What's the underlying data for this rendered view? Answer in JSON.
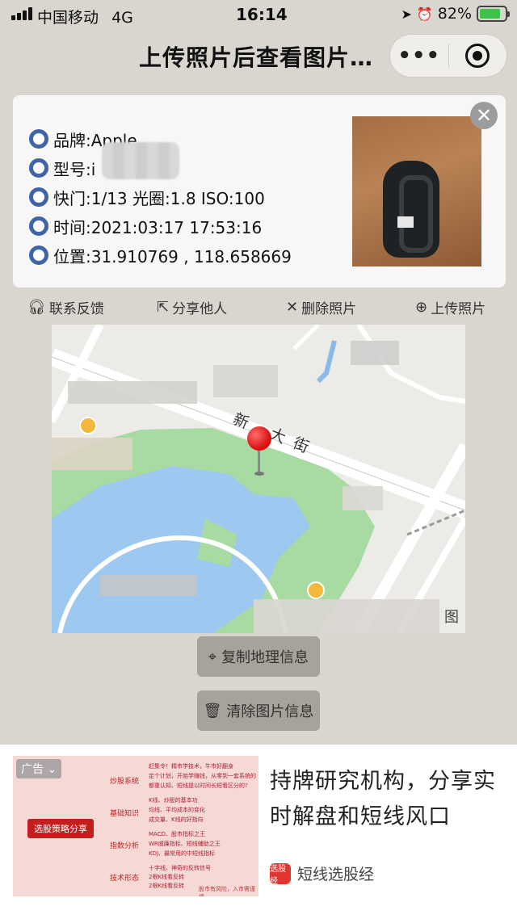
{
  "status_bar": {
    "carrier": "中国移动",
    "network": "4G",
    "time": "16:14",
    "battery": "82%",
    "battery_level": 0.82
  },
  "nav": {
    "title": "上传照片后查看图片…",
    "more_glyph": "•••"
  },
  "photo_info": {
    "brand": "品牌:Apple",
    "model": "型号:i",
    "shutter": "快门:1/13 光圈:1.8 ISO:100",
    "time": "时间:2021:03:17 17:53:16",
    "location": "位置:31.910769 , 118.658669"
  },
  "actions": {
    "contact": "联系反馈",
    "share": "分享他人",
    "delete": "删除照片",
    "upload": "上传照片"
  },
  "map": {
    "street": "新 大街",
    "corner": "图"
  },
  "buttons": {
    "copy_geo": "复制地理信息",
    "clear_info": "清除图片信息"
  },
  "ad": {
    "label": "广告",
    "image_button": "选股策略分享",
    "categories": [
      "炒股系统",
      "基础知识",
      "指数分析",
      "技术形态"
    ],
    "lines": [
      "赶集令！精市学技术，牛市好翻身",
      "定个计划，开始学赚钱，从零到一套系统的",
      "都重认知、短线提以时间长短看区分的?",
      "K线、炒股的基本功",
      "均线、平均成本的变化",
      "成交量、K线的好指向",
      "MACD、股市指标之王",
      "WR威廉指标、短线辅助之王",
      "KDJ、最常用的中短线指标",
      "十字线、神奇的反转信号",
      "2根K线看反转",
      "2根K线看反转"
    ],
    "footer": "股市有风险，入市需谨慎",
    "title": "持牌研究机构，分享实时解盘和短线风口",
    "source": "短线选股经",
    "source_logo": "选股经"
  }
}
